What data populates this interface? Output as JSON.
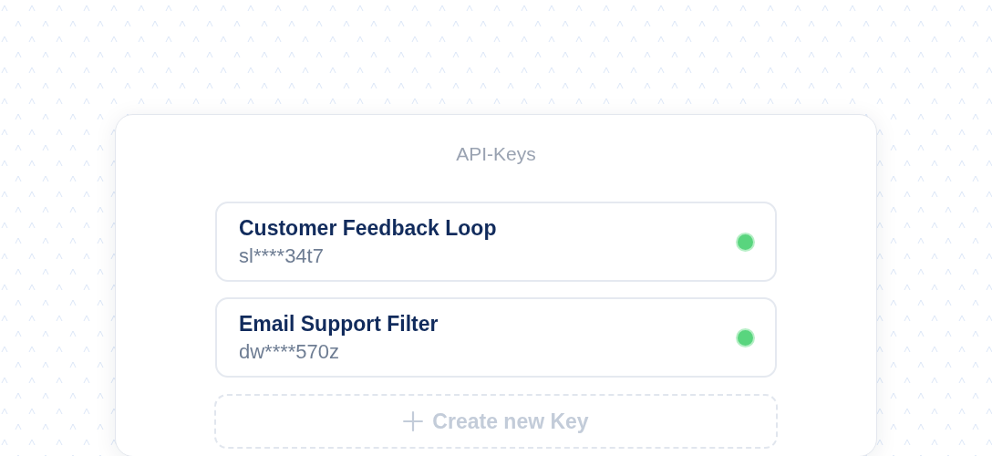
{
  "panel": {
    "title": "API-Keys"
  },
  "keys": [
    {
      "name": "Customer Feedback Loop",
      "masked_key": "sl****34t7",
      "active": true
    },
    {
      "name": "Email Support Filter",
      "masked_key": "dw****570z",
      "active": true
    }
  ],
  "create_button": {
    "label": "Create new Key",
    "disabled": true
  }
}
